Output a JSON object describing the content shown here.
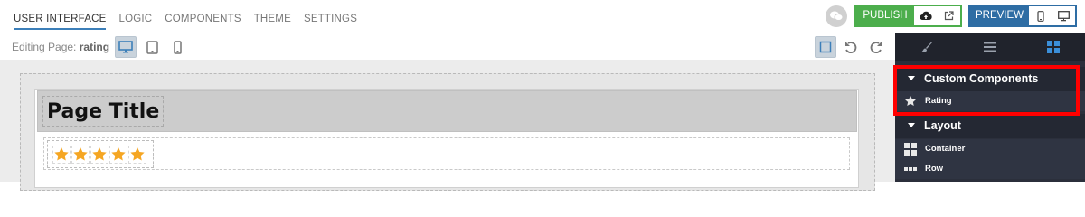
{
  "tabs": [
    {
      "label": "USER INTERFACE"
    },
    {
      "label": "LOGIC"
    },
    {
      "label": "COMPONENTS"
    },
    {
      "label": "THEME"
    },
    {
      "label": "SETTINGS"
    }
  ],
  "actions": {
    "publish_label": "PUBLISH",
    "preview_label": "PREVIEW"
  },
  "editbar": {
    "editing_prefix": "Editing Page:",
    "page_name": "rating"
  },
  "canvas": {
    "page_title": "Page Title",
    "star_count": 5,
    "star_color": "#f5a623"
  },
  "panel": {
    "sections": [
      {
        "title": "Custom Components",
        "items": [
          {
            "label": "Rating",
            "icon": "star-icon"
          }
        ]
      },
      {
        "title": "Layout",
        "items": [
          {
            "label": "Container",
            "icon": "grid-icon"
          },
          {
            "label": "Row",
            "icon": "row-icon"
          }
        ]
      }
    ]
  },
  "colors": {
    "publish": "#4cae4c",
    "preview": "#2e6da4",
    "panel_bg": "#2b2f3b",
    "highlight": "#ff0000",
    "active_tab_accent": "#3c7fb9"
  }
}
